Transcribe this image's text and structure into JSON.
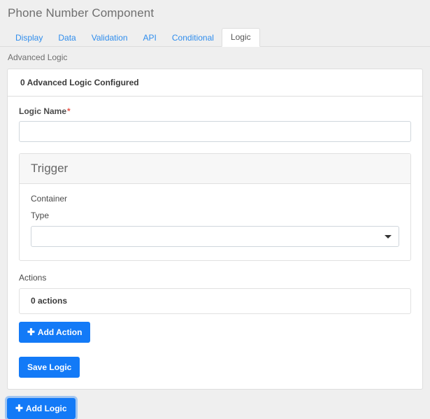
{
  "header": {
    "title": "Phone Number Component"
  },
  "tabs": [
    {
      "label": "Display",
      "active": false
    },
    {
      "label": "Data",
      "active": false
    },
    {
      "label": "Validation",
      "active": false
    },
    {
      "label": "API",
      "active": false
    },
    {
      "label": "Conditional",
      "active": false
    },
    {
      "label": "Logic",
      "active": true
    }
  ],
  "section": {
    "label": "Advanced Logic"
  },
  "panel": {
    "header": "0 Advanced Logic Configured"
  },
  "form": {
    "logic_name": {
      "label": "Logic Name",
      "required_marker": "*",
      "value": "",
      "placeholder": ""
    }
  },
  "trigger": {
    "title": "Trigger",
    "container_label": "Container",
    "type_label": "Type",
    "type_value": "",
    "type_options": [
      ""
    ]
  },
  "actions": {
    "label": "Actions",
    "summary": "0 actions",
    "add_button": {
      "icon": "plus-icon",
      "label": "Add Action"
    }
  },
  "buttons": {
    "save_logic": "Save Logic",
    "add_logic": {
      "icon": "plus-icon",
      "label": "Add Logic"
    }
  },
  "colors": {
    "primary": "#137af7",
    "tab_link": "#2f8ded",
    "required": "#e9564b",
    "page_bg": "#efefef",
    "panel_bg": "#ffffff",
    "border": "#dddddd"
  }
}
